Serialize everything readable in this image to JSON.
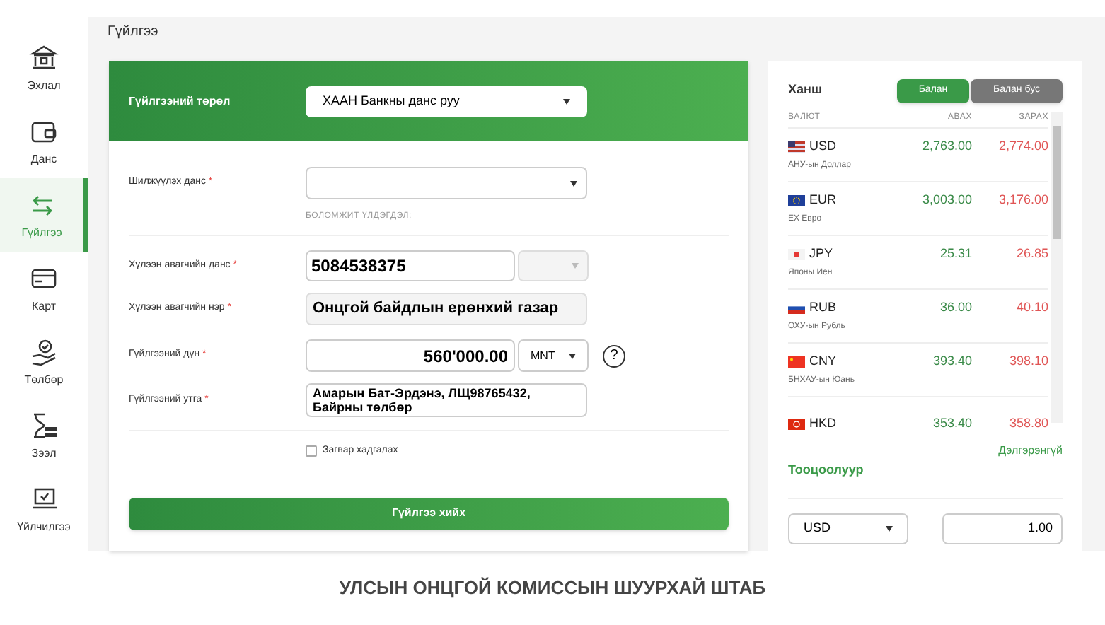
{
  "sidebar": {
    "items": [
      {
        "label": "Эхлал",
        "selected": false
      },
      {
        "label": "Данс",
        "selected": false
      },
      {
        "label": "Гүйлгээ",
        "selected": true
      },
      {
        "label": "Карт",
        "selected": false
      },
      {
        "label": "Төлбөр",
        "selected": false
      },
      {
        "label": "Зээл",
        "selected": false
      },
      {
        "label": "Үйлчилгээ",
        "selected": false
      }
    ]
  },
  "page_title": "Гүйлгээ",
  "form": {
    "type_label": "Гүйлгээний төрөл",
    "type_value": "ХААН Банкны данс руу",
    "fields": [
      {
        "kind": "select",
        "label": "Шилжүүлэх данс",
        "required_mark": "*",
        "note": "БОЛОМЖИТ ҮЛДЭГДЭЛ:"
      },
      {
        "kind": "account",
        "label": "Хүлээн авагчийн данс",
        "required_mark": "*",
        "value": "5084538375"
      },
      {
        "kind": "readonly",
        "label": "Хүлээн авагчийн нэр",
        "required_mark": "*",
        "value": "Онцгой байдлын ерөнхий газар"
      },
      {
        "kind": "amount",
        "label": "Гүйлгээний дүн",
        "required_mark": "*",
        "value": "560'000.00",
        "currency": "MNT",
        "help": "?"
      },
      {
        "kind": "memo",
        "label": "Гүйлгээний утга",
        "required_mark": "*",
        "value": "Амарын Бат-Эрдэнэ, ЛЩ98765432, Байрны төлбөр"
      }
    ],
    "save_template": {
      "label": "Загвар хадгалах",
      "checked": false
    },
    "submit": "Гүйлгээ хийх"
  },
  "rates": {
    "title": "Ханш",
    "toggle": [
      {
        "label": "Балан",
        "selected": true
      },
      {
        "label": "Балан бус",
        "selected": false
      }
    ],
    "columns": [
      "ВАЛЮТ",
      "АВАХ",
      "ЗАРАХ"
    ],
    "rows": [
      {
        "code": "USD",
        "name": "АНУ-ын Доллар",
        "buy": "2,763.00",
        "sell": "2,774.00"
      },
      {
        "code": "EUR",
        "name": "ЕХ Евро",
        "buy": "3,003.00",
        "sell": "3,176.00"
      },
      {
        "code": "JPY",
        "name": "Японы Иен",
        "buy": "25.31",
        "sell": "26.85"
      },
      {
        "code": "RUB",
        "name": "ОХУ-ын Рубль",
        "buy": "36.00",
        "sell": "40.10"
      },
      {
        "code": "CNY",
        "name": "БНХАУ-ын Юань",
        "buy": "393.40",
        "sell": "398.10"
      },
      {
        "code": "HKD",
        "buy": "353.40",
        "sell": "358.80"
      }
    ],
    "more_link": "Дэлгэрэнгүй",
    "calculator": {
      "title": "Тооцоолуур",
      "currency": "USD",
      "amount": "1.00"
    }
  },
  "caption": "УЛСЫН ОНЦГОЙ КОМИССЫН ШУУРХАЙ ШТАБ"
}
